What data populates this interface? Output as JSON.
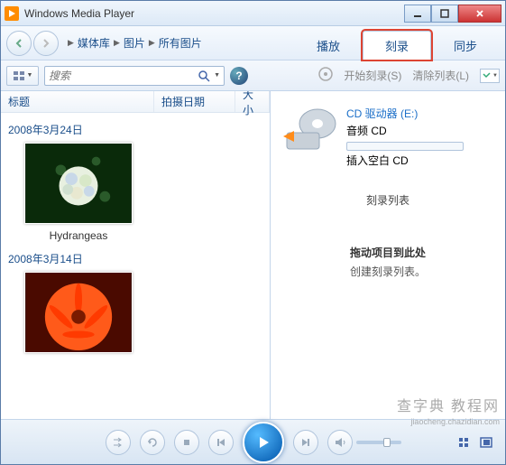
{
  "titlebar": {
    "title": "Windows Media Player"
  },
  "breadcrumb": {
    "items": [
      "媒体库",
      "图片",
      "所有图片"
    ]
  },
  "tabs": {
    "play": "播放",
    "burn": "刻录",
    "sync": "同步"
  },
  "search": {
    "placeholder": "搜索"
  },
  "right_toolbar": {
    "start_burn": "开始刻录(S)",
    "clear_list": "清除列表(L)"
  },
  "columns": {
    "title": "标题",
    "date_taken": "拍摄日期",
    "size": "大小"
  },
  "library": {
    "groups": [
      {
        "date": "2008年3月24日",
        "items": [
          {
            "name": "Hydrangeas"
          }
        ]
      },
      {
        "date": "2008年3月14日",
        "items": [
          {
            "name": ""
          }
        ]
      }
    ]
  },
  "burn_panel": {
    "drive": "CD 驱动器 (E:)",
    "media_type": "音频 CD",
    "hint": "插入空白 CD",
    "list_title": "刻录列表",
    "drop_line1": "拖动项目到此处",
    "drop_line2": "创建刻录列表。"
  },
  "watermark": {
    "main": "查字典 教程网",
    "sub": "jiaocheng.chazidian.com"
  }
}
